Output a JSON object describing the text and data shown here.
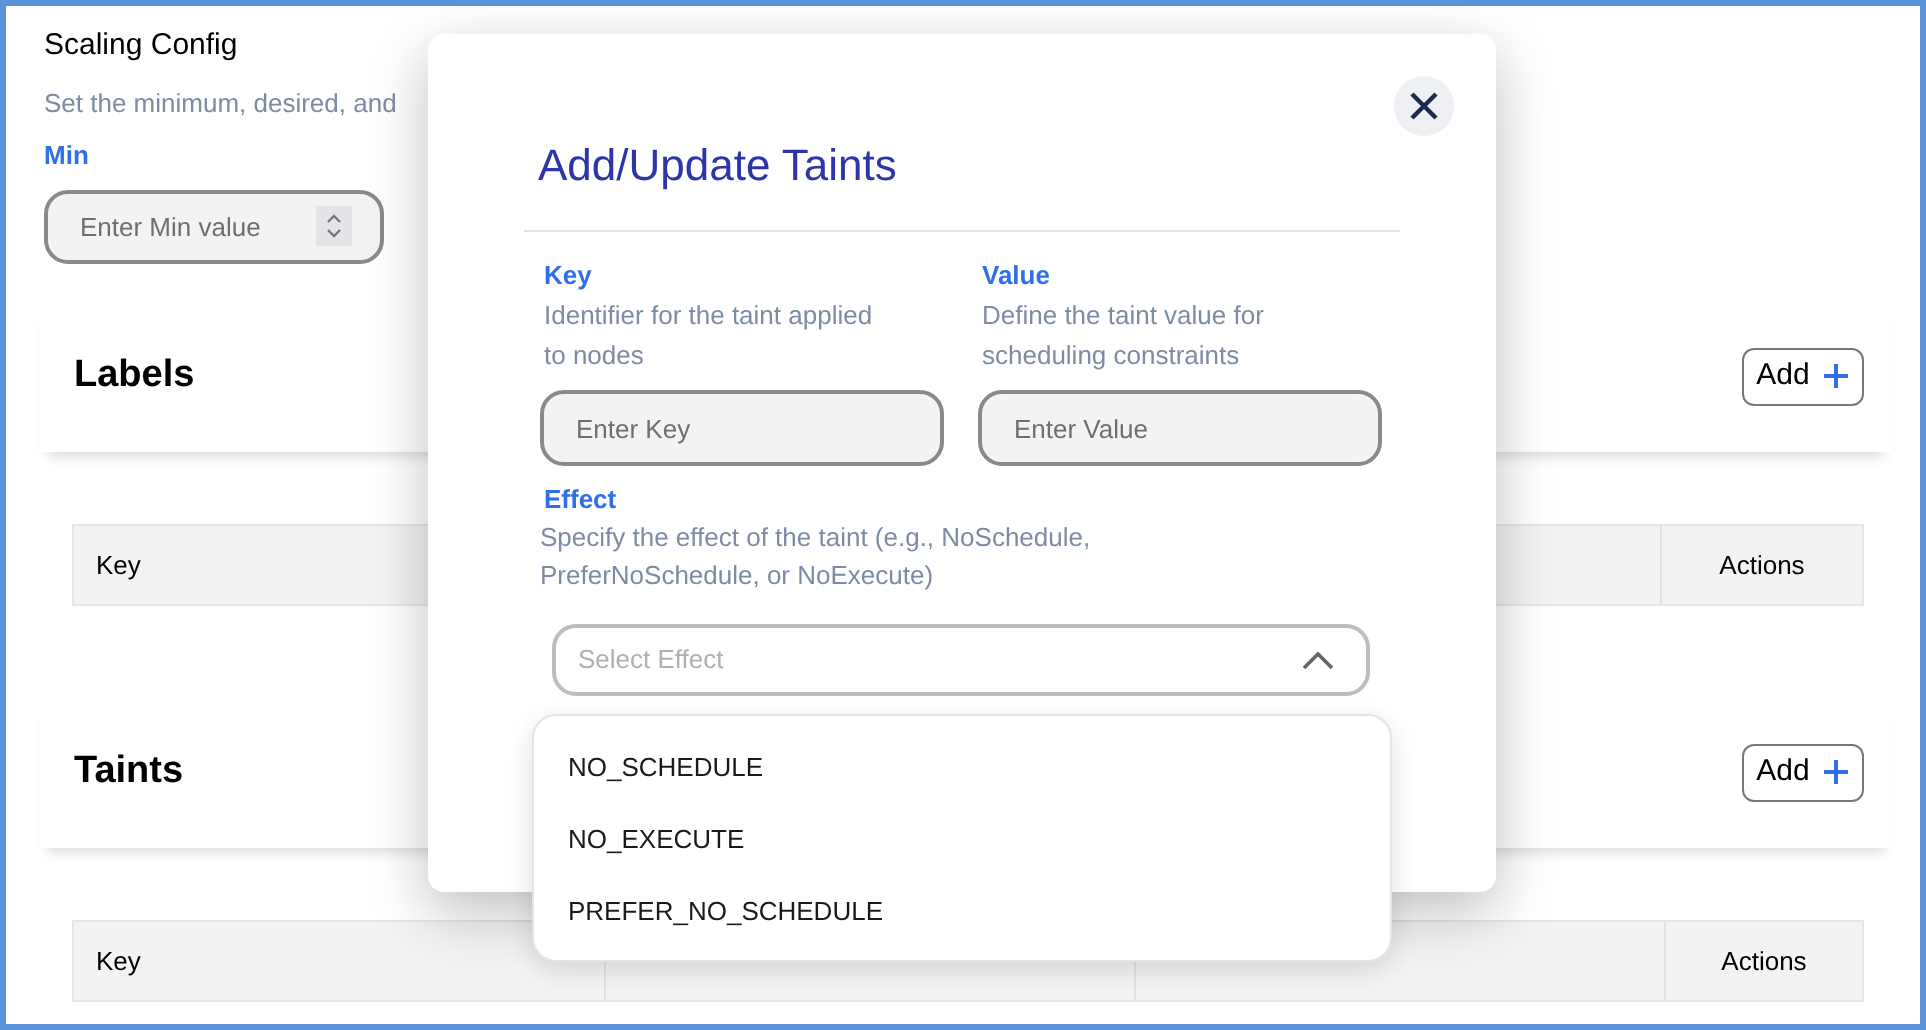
{
  "scaling_config": {
    "title": "Scaling Config",
    "description": "Set the minimum, desired, and",
    "fields": [
      {
        "label": "Min",
        "placeholder": "Enter Min value"
      }
    ]
  },
  "labels": {
    "title": "Labels",
    "add_button": "Add",
    "table": {
      "columns": [
        "Key",
        "Actions"
      ]
    }
  },
  "taints": {
    "title": "Taints",
    "add_button": "Add",
    "table": {
      "columns": [
        "Key",
        "Actions"
      ]
    }
  },
  "modal": {
    "title": "Add/Update Taints",
    "fields": [
      {
        "label": "Key",
        "description": "Identifier for the taint applied to nodes",
        "placeholder": "Enter Key"
      },
      {
        "label": "Value",
        "description": "Define the taint value for scheduling constraints",
        "placeholder": "Enter Value"
      }
    ],
    "effect": {
      "label": "Effect",
      "description": "Specify the effect of the taint (e.g., NoSchedule, PreferNoSchedule, or NoExecute)",
      "placeholder": "Select Effect",
      "expanded": true,
      "options": [
        {
          "label": "NO_SCHEDULE",
          "selected": false
        },
        {
          "label": "NO_EXECUTE",
          "selected": false
        },
        {
          "label": "PREFER_NO_SCHEDULE",
          "selected": false
        }
      ]
    }
  }
}
